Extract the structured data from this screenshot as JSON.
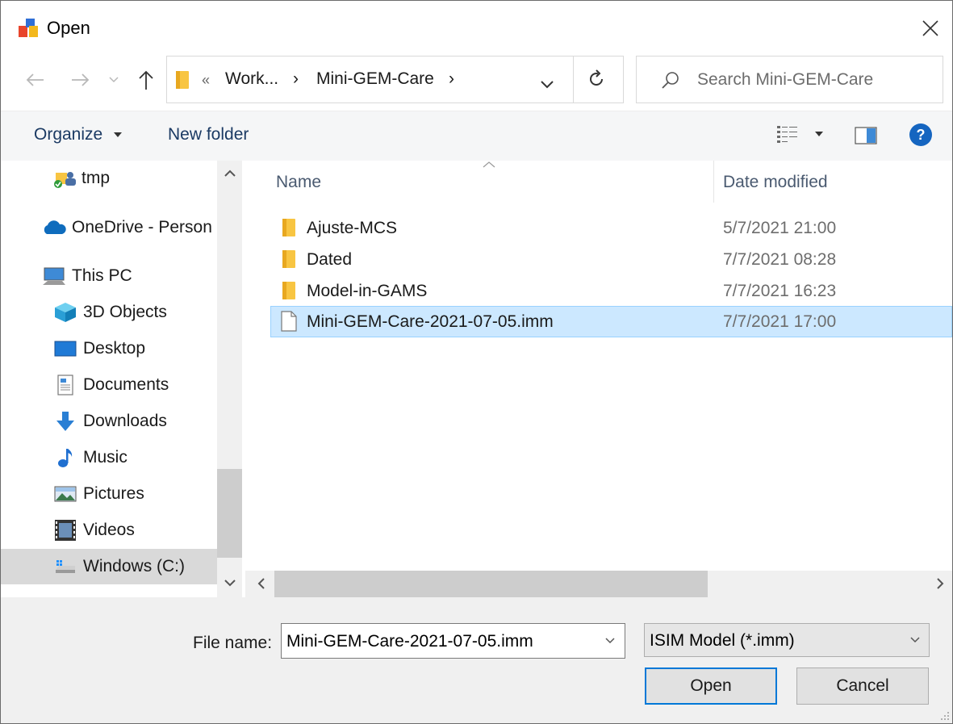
{
  "window": {
    "title": "Open"
  },
  "nav": {
    "back_icon": "arrow-left-icon",
    "forward_icon": "arrow-right-icon",
    "recent_icon": "chevron-down-icon",
    "up_icon": "arrow-up-icon"
  },
  "address": {
    "overflow": "«",
    "crumbs": [
      "Work...",
      "Mini-GEM-Care"
    ],
    "separator": "›"
  },
  "search": {
    "placeholder": "Search Mini-GEM-Care"
  },
  "toolbar": {
    "organize_label": "Organize",
    "new_folder_label": "New folder"
  },
  "sidebar": {
    "items": [
      {
        "label": "tmp",
        "icon": "user-folder-icon"
      },
      {
        "label": "OneDrive - Person",
        "icon": "cloud-icon"
      },
      {
        "label": "This PC",
        "icon": "computer-icon"
      },
      {
        "label": "3D Objects",
        "icon": "cube-icon"
      },
      {
        "label": "Desktop",
        "icon": "desktop-icon"
      },
      {
        "label": "Documents",
        "icon": "document-icon"
      },
      {
        "label": "Downloads",
        "icon": "download-icon"
      },
      {
        "label": "Music",
        "icon": "music-icon"
      },
      {
        "label": "Pictures",
        "icon": "picture-icon"
      },
      {
        "label": "Videos",
        "icon": "video-icon"
      },
      {
        "label": "Windows (C:)",
        "icon": "drive-icon"
      }
    ]
  },
  "files": {
    "columns": {
      "name": "Name",
      "date": "Date modified"
    },
    "rows": [
      {
        "name": "Ajuste-MCS",
        "date": "5/7/2021 21:00",
        "type": "folder"
      },
      {
        "name": "Dated",
        "date": "7/7/2021 08:28",
        "type": "folder"
      },
      {
        "name": "Model-in-GAMS",
        "date": "7/7/2021 16:23",
        "type": "folder"
      },
      {
        "name": "Mini-GEM-Care-2021-07-05.imm",
        "date": "7/7/2021 17:00",
        "type": "file",
        "selected": true
      }
    ]
  },
  "footer": {
    "file_name_label": "File name:",
    "file_name_value": "Mini-GEM-Care-2021-07-05.imm",
    "file_type_value": "ISIM Model (*.imm)",
    "open_label": "Open",
    "cancel_label": "Cancel"
  },
  "colors": {
    "accent": "#0078d7",
    "selection": "#cce8ff",
    "folder": "#f8c542"
  }
}
